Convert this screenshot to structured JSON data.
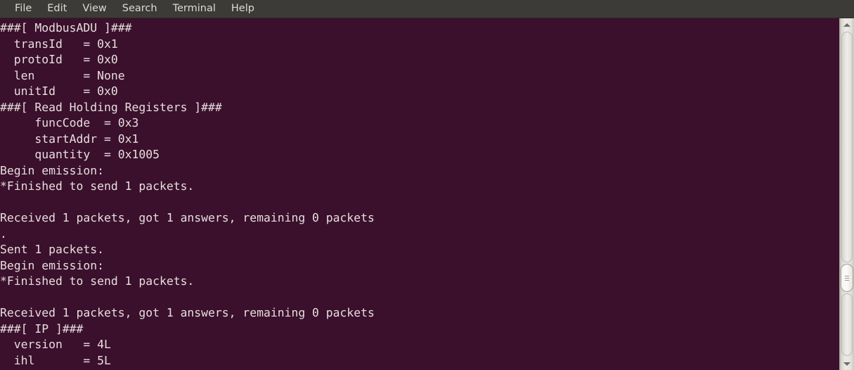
{
  "window": {
    "app_name": "Terminal",
    "background_color": "#3b102c",
    "menubar_color": "#3c3b37",
    "text_color": "#e6dede"
  },
  "menubar": {
    "items": [
      {
        "label": "File",
        "name": "menu-file"
      },
      {
        "label": "Edit",
        "name": "menu-edit"
      },
      {
        "label": "View",
        "name": "menu-view"
      },
      {
        "label": "Search",
        "name": "menu-search"
      },
      {
        "label": "Terminal",
        "name": "menu-terminal"
      },
      {
        "label": "Help",
        "name": "menu-help"
      }
    ]
  },
  "terminal": {
    "lines": [
      "###[ ModbusADU ]###",
      "  transId   = 0x1",
      "  protoId   = 0x0",
      "  len       = None",
      "  unitId    = 0x0",
      "###[ Read Holding Registers ]###",
      "     funcCode  = 0x3",
      "     startAddr = 0x1",
      "     quantity  = 0x1005",
      "Begin emission:",
      "*Finished to send 1 packets.",
      "",
      "Received 1 packets, got 1 answers, remaining 0 packets",
      ".",
      "Sent 1 packets.",
      "Begin emission:",
      "*Finished to send 1 packets.",
      "",
      "Received 1 packets, got 1 answers, remaining 0 packets",
      "###[ IP ]###",
      "  version   = 4L",
      "  ihl       = 5L"
    ]
  },
  "scrollbar": {
    "up_arrow": "scroll-up-arrow",
    "down_arrow": "scroll-down-arrow",
    "thumb": "scroll-thumb"
  }
}
